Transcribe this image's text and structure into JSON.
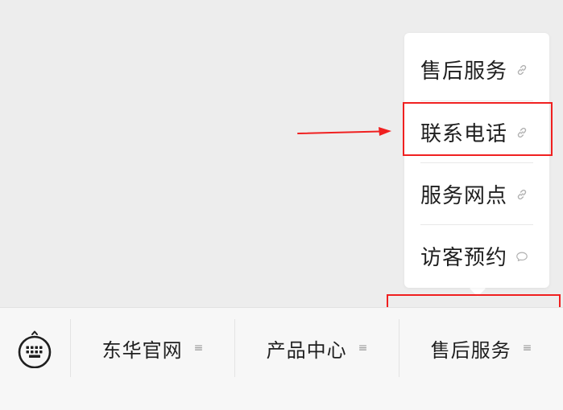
{
  "submenu": {
    "items": [
      {
        "label": "售后服务",
        "icon": "link-icon"
      },
      {
        "label": "联系电话",
        "icon": "link-icon"
      },
      {
        "label": "服务网点",
        "icon": "link-icon"
      },
      {
        "label": "访客预约",
        "icon": "chat-bubble-icon"
      }
    ]
  },
  "menu_bar": {
    "keyboard_icon": "keyboard-icon",
    "items": [
      {
        "label": "东华官网",
        "icon": "menu-icon"
      },
      {
        "label": "产品中心",
        "icon": "menu-icon"
      },
      {
        "label": "售后服务",
        "icon": "menu-icon"
      }
    ]
  },
  "colors": {
    "background": "#ededed",
    "panel": "#ffffff",
    "bar": "#f7f7f7",
    "annotation_red": "#f02020",
    "icon_gray": "#b0b0b0"
  }
}
